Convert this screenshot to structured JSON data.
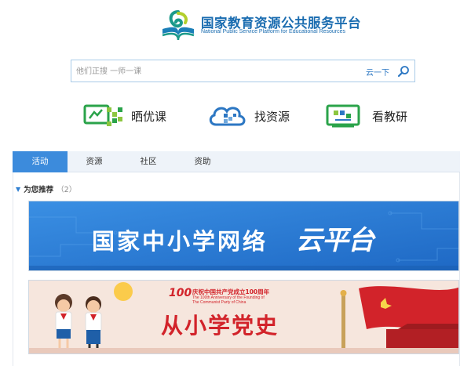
{
  "header": {
    "title_cn": "国家教育资源公共服务平台",
    "title_en": "National Public Service Platform for Educational Resources",
    "logo_icon": "book-logo-icon"
  },
  "search": {
    "placeholder": "他们正搜 一师一课",
    "cloud_label": "云一下",
    "icon": "search-icon"
  },
  "features": [
    {
      "label": "晒优课",
      "icon": "screen-course-icon"
    },
    {
      "label": "找资源",
      "icon": "cloud-resource-icon"
    },
    {
      "label": "看教研",
      "icon": "teaching-research-icon"
    }
  ],
  "tabs": [
    {
      "label": "活动",
      "active": true
    },
    {
      "label": "资源",
      "active": false
    },
    {
      "label": "社区",
      "active": false
    },
    {
      "label": "资助",
      "active": false
    }
  ],
  "section": {
    "title": "为您推荐",
    "count": "（2）"
  },
  "banners": [
    {
      "title": "国家中小学网络",
      "emblem": "云平台",
      "bg": "#2e7fd8"
    },
    {
      "badge": "100",
      "caption_cn": "庆祝中国共产党成立100周年",
      "caption_en_1": "The 100th Anniversary of the Founding of",
      "caption_en_2": "The Communist Party of China",
      "title": "从小学党史",
      "bg": "#f7e9e2"
    }
  ],
  "colors": {
    "brand_blue": "#1a6cb0",
    "tab_active": "#3c8bdc",
    "party_red": "#d2232a"
  }
}
